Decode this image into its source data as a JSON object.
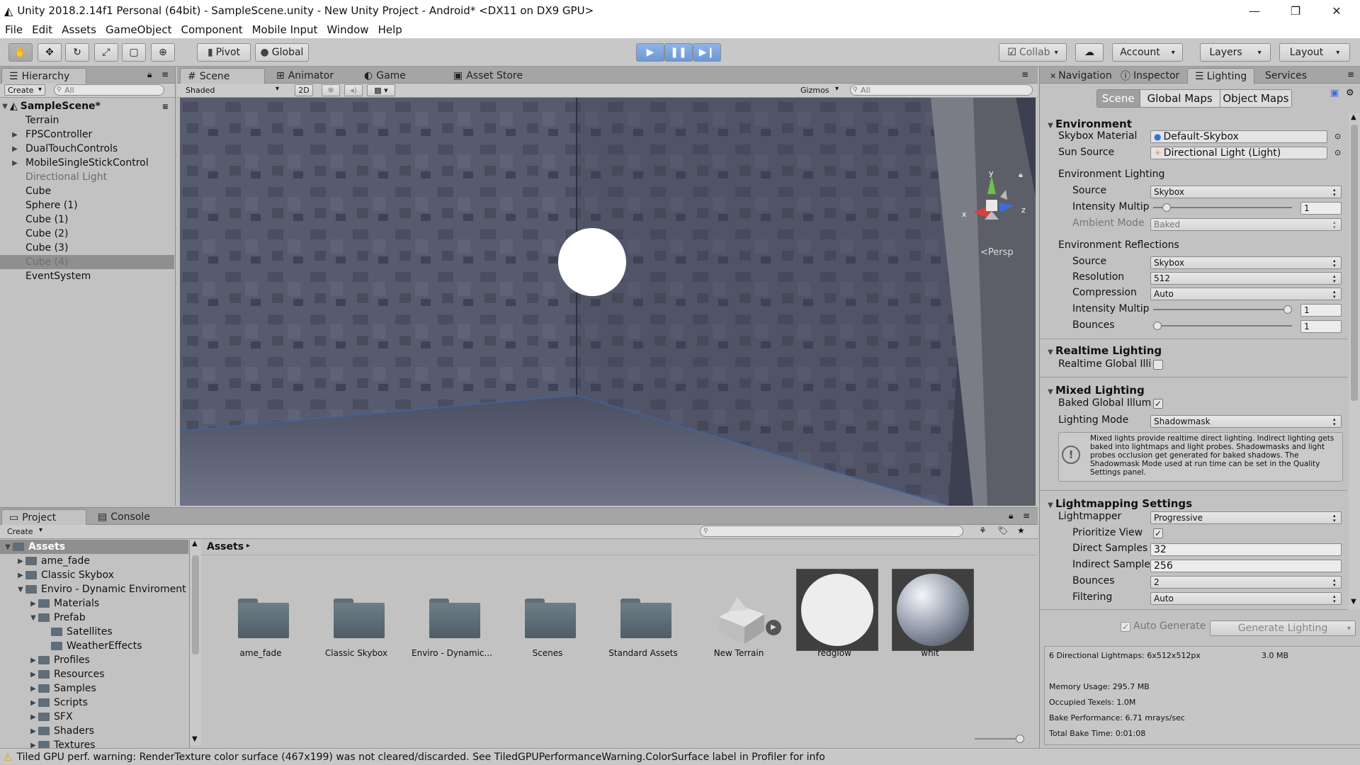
{
  "window": {
    "title": "Unity 2018.2.14f1 Personal (64bit) - SampleScene.unity - New Unity Project - Android* <DX11 on DX9 GPU>",
    "minimize": "—",
    "maximize": "❐",
    "close": "✕"
  },
  "menu": [
    "File",
    "Edit",
    "Assets",
    "GameObject",
    "Component",
    "Mobile Input",
    "Window",
    "Help"
  ],
  "toolbar": {
    "pivot": "Pivot",
    "global": "Global",
    "collab": "Collab",
    "account": "Account",
    "layers": "Layers",
    "layout": "Layout"
  },
  "hierarchy": {
    "tab": "Hierarchy",
    "create": "Create",
    "search": "All",
    "scene": "SampleScene*",
    "items": [
      {
        "label": "Terrain",
        "arrow": false,
        "dim": false,
        "selected": false
      },
      {
        "label": "FPSController",
        "arrow": true,
        "dim": false,
        "selected": false
      },
      {
        "label": "DualTouchControls",
        "arrow": true,
        "dim": false,
        "selected": false
      },
      {
        "label": "MobileSingleStickControl",
        "arrow": true,
        "dim": false,
        "selected": false
      },
      {
        "label": "Directional Light",
        "arrow": false,
        "dim": true,
        "selected": false
      },
      {
        "label": "Cube",
        "arrow": false,
        "dim": false,
        "selected": false
      },
      {
        "label": "Sphere (1)",
        "arrow": false,
        "dim": false,
        "selected": false
      },
      {
        "label": "Cube (1)",
        "arrow": false,
        "dim": false,
        "selected": false
      },
      {
        "label": "Cube (2)",
        "arrow": false,
        "dim": false,
        "selected": false
      },
      {
        "label": "Cube (3)",
        "arrow": false,
        "dim": false,
        "selected": false
      },
      {
        "label": "Cube (4)",
        "arrow": false,
        "dim": true,
        "selected": true
      },
      {
        "label": "EventSystem",
        "arrow": false,
        "dim": false,
        "selected": false
      }
    ]
  },
  "scene_view": {
    "tabs": [
      "Scene",
      "Animator",
      "Game",
      "Asset Store"
    ],
    "shading": "Shaded",
    "mode_2d": "2D",
    "gizmos": "Gizmos",
    "search": "All",
    "persp": "<Persp",
    "axis_x": "x",
    "axis_y": "y",
    "axis_z": "z"
  },
  "project": {
    "tabs": [
      "Project",
      "Console"
    ],
    "create": "Create",
    "breadcrumb": "Assets",
    "tree": [
      {
        "label": "Assets",
        "depth": 0,
        "arrow": "open",
        "selected": true
      },
      {
        "label": "ame_fade",
        "depth": 1,
        "arrow": "closed"
      },
      {
        "label": "Classic Skybox",
        "depth": 1,
        "arrow": "closed"
      },
      {
        "label": "Enviro - Dynamic Enviroment",
        "depth": 1,
        "arrow": "open"
      },
      {
        "label": "Materials",
        "depth": 2,
        "arrow": "closed"
      },
      {
        "label": "Prefab",
        "depth": 2,
        "arrow": "open"
      },
      {
        "label": "Satellites",
        "depth": 3,
        "arrow": "none"
      },
      {
        "label": "WeatherEffects",
        "depth": 3,
        "arrow": "none"
      },
      {
        "label": "Profiles",
        "depth": 2,
        "arrow": "closed"
      },
      {
        "label": "Resources",
        "depth": 2,
        "arrow": "closed"
      },
      {
        "label": "Samples",
        "depth": 2,
        "arrow": "closed"
      },
      {
        "label": "Scripts",
        "depth": 2,
        "arrow": "closed"
      },
      {
        "label": "SFX",
        "depth": 2,
        "arrow": "closed"
      },
      {
        "label": "Shaders",
        "depth": 2,
        "arrow": "closed"
      },
      {
        "label": "Textures",
        "depth": 2,
        "arrow": "closed"
      }
    ],
    "assets": [
      {
        "label": "ame_fade",
        "kind": "folder"
      },
      {
        "label": "Classic Skybox",
        "kind": "folder"
      },
      {
        "label": "Enviro - Dynamic...",
        "kind": "folder"
      },
      {
        "label": "Scenes",
        "kind": "folder"
      },
      {
        "label": "Standard Assets",
        "kind": "folder"
      },
      {
        "label": "New Terrain",
        "kind": "terrain"
      },
      {
        "label": "redglow",
        "kind": "white-material"
      },
      {
        "label": "whit",
        "kind": "grey-material"
      }
    ]
  },
  "right_panel": {
    "tabs": [
      "Navigation",
      "Inspector",
      "Lighting",
      "Services"
    ],
    "subtabs": [
      "Scene",
      "Global Maps",
      "Object Maps"
    ],
    "environment": {
      "title": "Environment",
      "skybox_label": "Skybox Material",
      "skybox_value": "Default-Skybox",
      "sun_label": "Sun Source",
      "sun_value": "Directional Light (Light)",
      "lighting_title": "Environment Lighting",
      "source_label": "Source",
      "source_value": "Skybox",
      "intensity_label": "Intensity Multip",
      "intensity_value": "1",
      "intensity_fraction": 0.07,
      "ambient_label": "Ambient Mode",
      "ambient_value": "Baked",
      "reflections_title": "Environment Reflections",
      "r_source_label": "Source",
      "r_source_value": "Skybox",
      "resolution_label": "Resolution",
      "resolution_value": "512",
      "compression_label": "Compression",
      "compression_value": "Auto",
      "r_intensity_label": "Intensity Multip",
      "r_intensity_value": "1",
      "r_intensity_fraction": 1.0,
      "bounces_label": "Bounces",
      "bounces_value": "1",
      "bounces_fraction": 0.0
    },
    "realtime": {
      "title": "Realtime Lighting",
      "gi_label": "Realtime Global Illi",
      "gi_checked": false
    },
    "mixed": {
      "title": "Mixed Lighting",
      "baked_label": "Baked Global Illum",
      "baked_checked": true,
      "mode_label": "Lighting Mode",
      "mode_value": "Shadowmask",
      "info": "Mixed lights provide realtime direct lighting. Indirect lighting gets baked into lightmaps and light probes. Shadowmasks and light probes occlusion get generated for baked shadows. The Shadowmask Mode used at run time can be set in the Quality Settings panel."
    },
    "lightmapping": {
      "title": "Lightmapping Settings",
      "lightmapper_label": "Lightmapper",
      "lightmapper_value": "Progressive",
      "prioritize_label": "Prioritize View",
      "prioritize_checked": true,
      "direct_label": "Direct Samples",
      "direct_value": "32",
      "indirect_label": "Indirect Sample",
      "indirect_value": "256",
      "bounces_label": "Bounces",
      "bounces_value": "2",
      "filtering_label": "Filtering",
      "filtering_value": "Auto"
    },
    "auto_generate": "Auto Generate",
    "generate_button": "Generate Lighting",
    "stats": {
      "lightmaps": "6 Directional Lightmaps: 6x512x512px",
      "size": "3.0 MB",
      "memory": "Memory Usage: 295.7 MB",
      "texels": "Occupied Texels: 1.0M",
      "performance": "Bake Performance: 6.71 mrays/sec",
      "time": "Total Bake Time: 0:01:08"
    }
  },
  "status": {
    "text": "Tiled GPU perf. warning: RenderTexture color surface (467x199) was not cleared/discarded. See TiledGPUPerformanceWarning.ColorSurface label in Profiler for info"
  },
  "colors": {
    "play": "#6d97d6",
    "panel": "#c2c2c2",
    "selected": "#8f8f8f"
  }
}
